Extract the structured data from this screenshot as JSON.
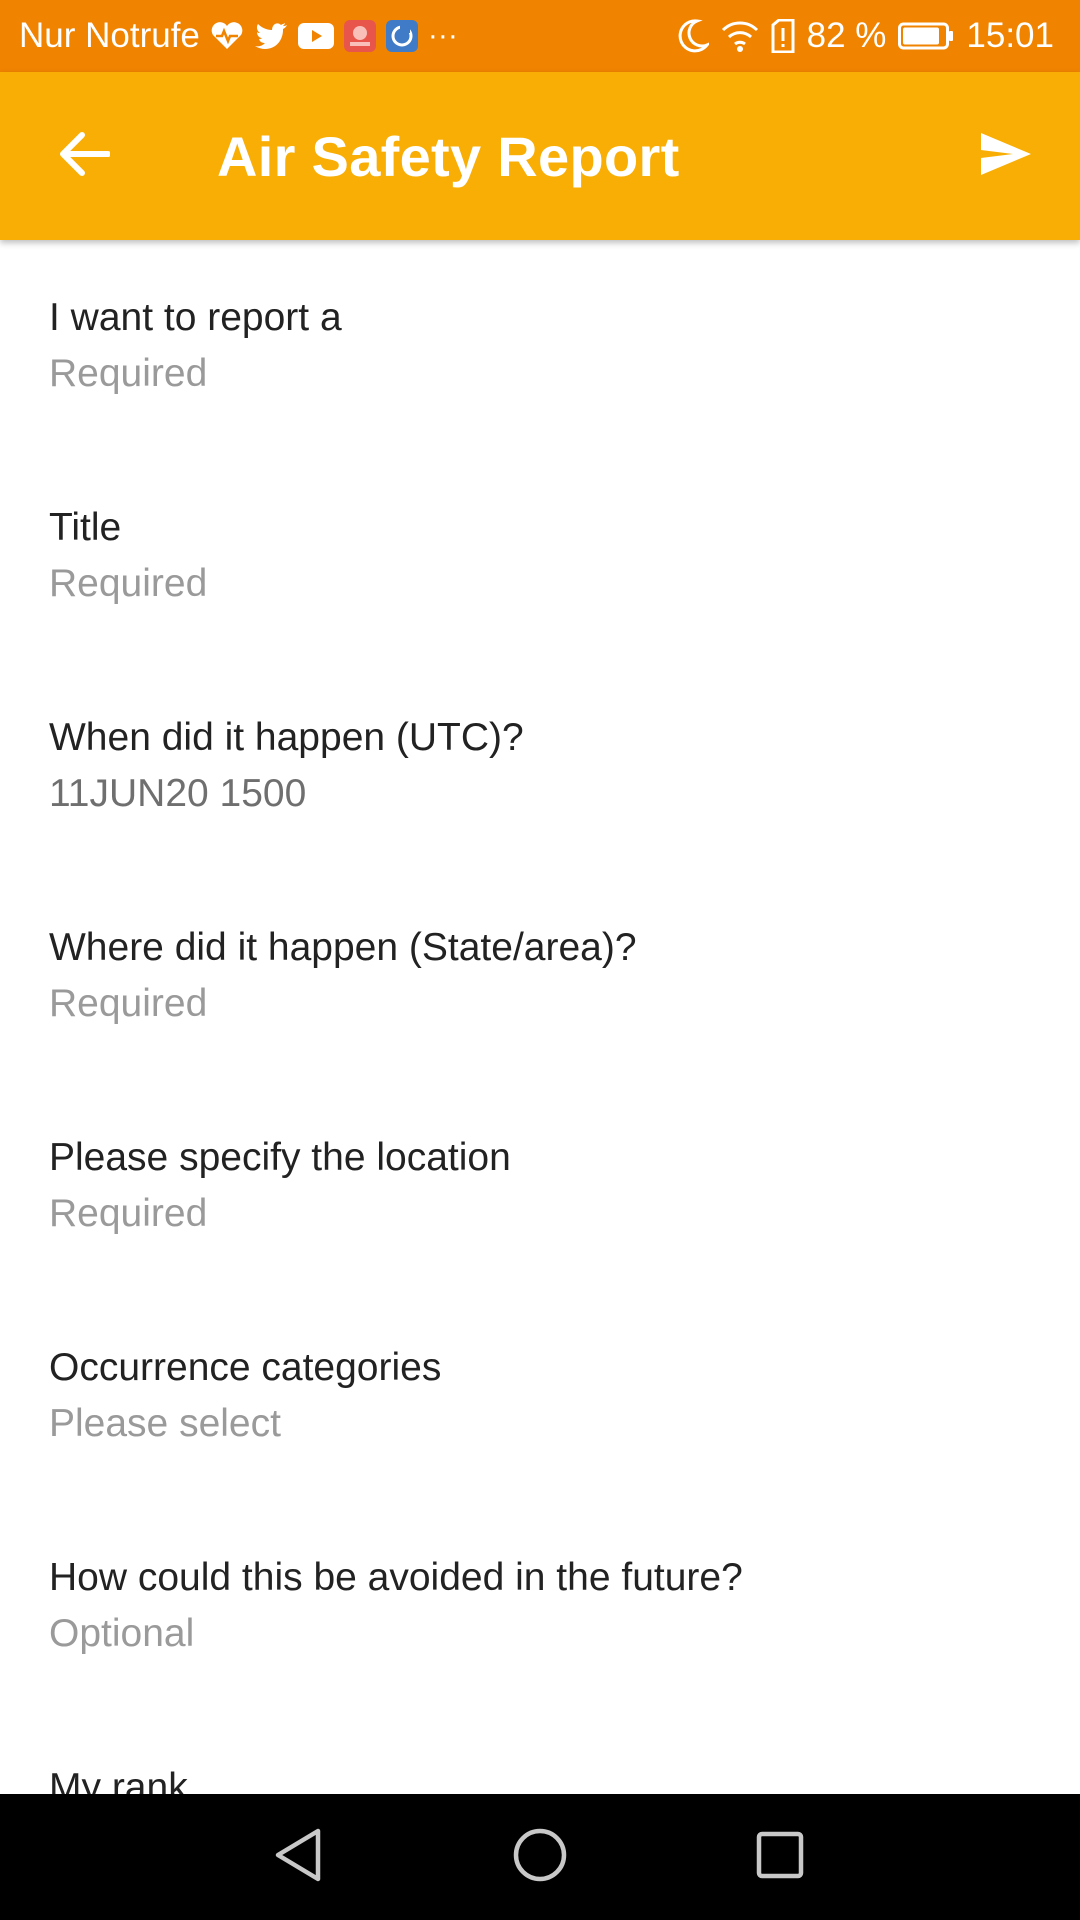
{
  "status_bar": {
    "carrier": "Nur Notrufe",
    "battery_percent": "82 %",
    "time": "15:01",
    "more": "···",
    "icons_left": [
      "health-heart-icon",
      "twitter-icon",
      "youtube-icon",
      "huawei-app-icon",
      "app-icon",
      "more-dots-icon"
    ],
    "icons_right": [
      "moon-icon",
      "wifi-icon",
      "sim-alert-icon",
      "battery-icon"
    ]
  },
  "app_bar": {
    "title": "Air Safety Report",
    "back_icon": "arrow-left-icon",
    "send_icon": "send-icon"
  },
  "form": {
    "fields": [
      {
        "label": "I want to report a",
        "value": "Required"
      },
      {
        "label": "Title",
        "value": "Required"
      },
      {
        "label": "When did it happen (UTC)?",
        "value": "11JUN20 1500"
      },
      {
        "label": "Where did it happen (State/area)?",
        "value": "Required"
      },
      {
        "label": "Please specify the location",
        "value": "Required"
      },
      {
        "label": "Occurrence categories",
        "value": "Please select"
      },
      {
        "label": "How could this be avoided in the future?",
        "value": "Optional"
      },
      {
        "label": "My rank",
        "value": ""
      }
    ]
  },
  "nav_bar": {
    "buttons": [
      "back-triangle-icon",
      "home-circle-icon",
      "recents-square-icon"
    ]
  },
  "colors": {
    "status_bar": "#f08300",
    "app_bar": "#f8ae05",
    "text_primary": "#222222",
    "text_hint": "#9a9a9a"
  }
}
